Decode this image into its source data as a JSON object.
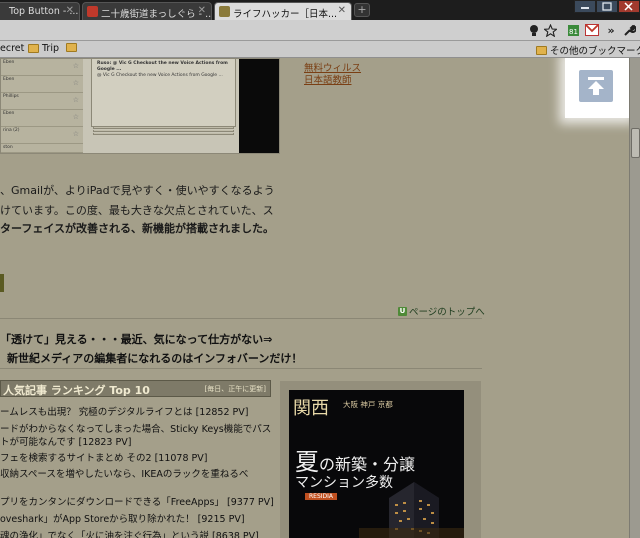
{
  "tabs": [
    {
      "label": "Top Button - ..."
    },
    {
      "label": "二十歳街道まっしぐら - ..."
    },
    {
      "label": "ライフハッカー［日本..."
    }
  ],
  "bookmarks": {
    "items": [
      "ecret",
      "Trip"
    ],
    "other": "その他のブックマーク"
  },
  "toolbar_icons": [
    "bulb-icon",
    "star-icon",
    "extension-icon",
    "gmail-icon",
    "overflow-chevron-icon",
    "wrench-icon"
  ],
  "article": {
    "links": [
      "無料ウィルス",
      "日本語教師"
    ],
    "gmail_shot": {
      "preview_title": "Ruso: @ Vic G Checkout the new Voice Actions from Google ...",
      "preview_body": "@ Vic G Checkout the new Voice Actions from Google ...",
      "rows": [
        "Eben",
        "Eben",
        "Phillips",
        "Eben",
        "rina (2)",
        "ston"
      ]
    },
    "lines": [
      "、Gmailが、よりiPadで見やすく・使いやすくなるよう",
      "けています。この度、最も大きな欠点とされていた、ス",
      "ターフェイスが改善される、新機能が搭載されました。"
    ],
    "to_top": "ページのトップへ",
    "promo_lines": [
      "「透けて」見える・・・最近、気になって仕方がない⇒",
      "新世紀メディアの編集者になれるのはインフォバーンだけ！"
    ]
  },
  "ranking": {
    "title": "人気記事 ランキング Top 10",
    "note": "[毎日、正午に更新]",
    "items": [
      "ームレスも出現？ 究極のデジタルライフとは [12852 PV]",
      "ードがわからなくなってしまった場合、Sticky Keys機能でパス",
      "トが可能なんです [12823 PV]",
      "フェを検索するサイトまとめ その2 [11078 PV]",
      "収納スペースを増やしたいなら、IKEAのラックを重ねるべ",
      "",
      "プリをカンタンにダウンロードできる「FreeApps」 [9377 PV]",
      "oveshark」がApp Storeから取り除かれた！ [9215 PV]",
      "魂の浄化」でなく「火に油を注ぐ行為」という説 [8638 PV]"
    ]
  },
  "ad": {
    "region": "関西",
    "cities": "大阪 神戸 京都",
    "headline_kanji": "夏",
    "headline_rest": "の新築・分譲",
    "subline": "マンション多数",
    "tag": "RESIDIA"
  },
  "back_to_top": {
    "icon": "back-to-top-icon"
  },
  "colors": {
    "page_bg": "#a49f8a",
    "link": "#7a3f14",
    "back_top_btn": "#a4b4c9"
  }
}
